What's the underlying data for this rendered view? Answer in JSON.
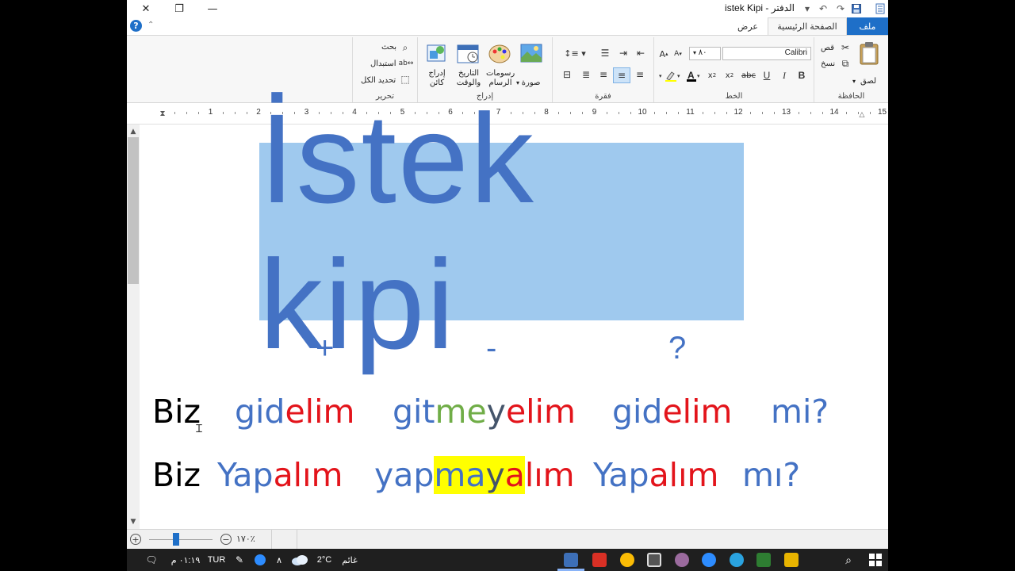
{
  "window": {
    "title": "istek Kipi - الدفتر"
  },
  "tabs": {
    "file": "ملف",
    "home": "الصفحة الرئيسية",
    "view": "عرض"
  },
  "ribbon": {
    "clipboard": {
      "label": "الحافظة",
      "paste": "لصق",
      "cut": "قص",
      "copy": "نسخ"
    },
    "font": {
      "label": "الخط",
      "family": "Calibri",
      "size": "٨٠"
    },
    "paragraph": {
      "label": "فقرة"
    },
    "insert": {
      "label": "إدراج",
      "picture": "صورة",
      "paint": "رسومات الرسام",
      "datetime": "التاريخ والوقت",
      "object": "إدراج كائن"
    },
    "editing": {
      "label": "تحرير",
      "find": "بحث",
      "replace": "استبدال",
      "select_all": "تحديد الكل"
    }
  },
  "ruler": {
    "numbers": [
      "1",
      "2",
      "3",
      "4",
      "5",
      "6",
      "7",
      "8",
      "9",
      "10",
      "11",
      "12",
      "13",
      "14",
      "15"
    ]
  },
  "document": {
    "title": "İstek kipi",
    "symbols": {
      "plus": "+",
      "minus": "-",
      "question": "?"
    },
    "line1": {
      "subject": "Biz",
      "pos": {
        "stem": "gid",
        "suffix": "elim"
      },
      "neg": {
        "stem": "git",
        "neg": "me",
        "y": "y",
        "suffix": "elim"
      },
      "q": {
        "stem": "gid",
        "suffix": "elim",
        "particle": "mi?"
      }
    },
    "line2": {
      "subject": "Biz",
      "pos": {
        "stem": "Yap",
        "suffix": "alım"
      },
      "neg": {
        "stem": "yap",
        "neg": "ma",
        "y": "y",
        "a": "a",
        "suffix": "lım"
      },
      "q": {
        "stem": "Yap",
        "suffix": "alım",
        "particle": "mı?"
      }
    }
  },
  "status": {
    "zoom": "١٧٠٪"
  },
  "taskbar": {
    "time": "٠١:١٩ م",
    "lang": "TUR",
    "weather_temp": "2°C",
    "weather_text": "غائم"
  },
  "colors": {
    "accent": "#1e6fc8",
    "title_blue": "#4472c4",
    "highlight": "#9fc9ee",
    "red": "#e3141b",
    "green": "#70ad47",
    "yellow": "#ffff00"
  }
}
